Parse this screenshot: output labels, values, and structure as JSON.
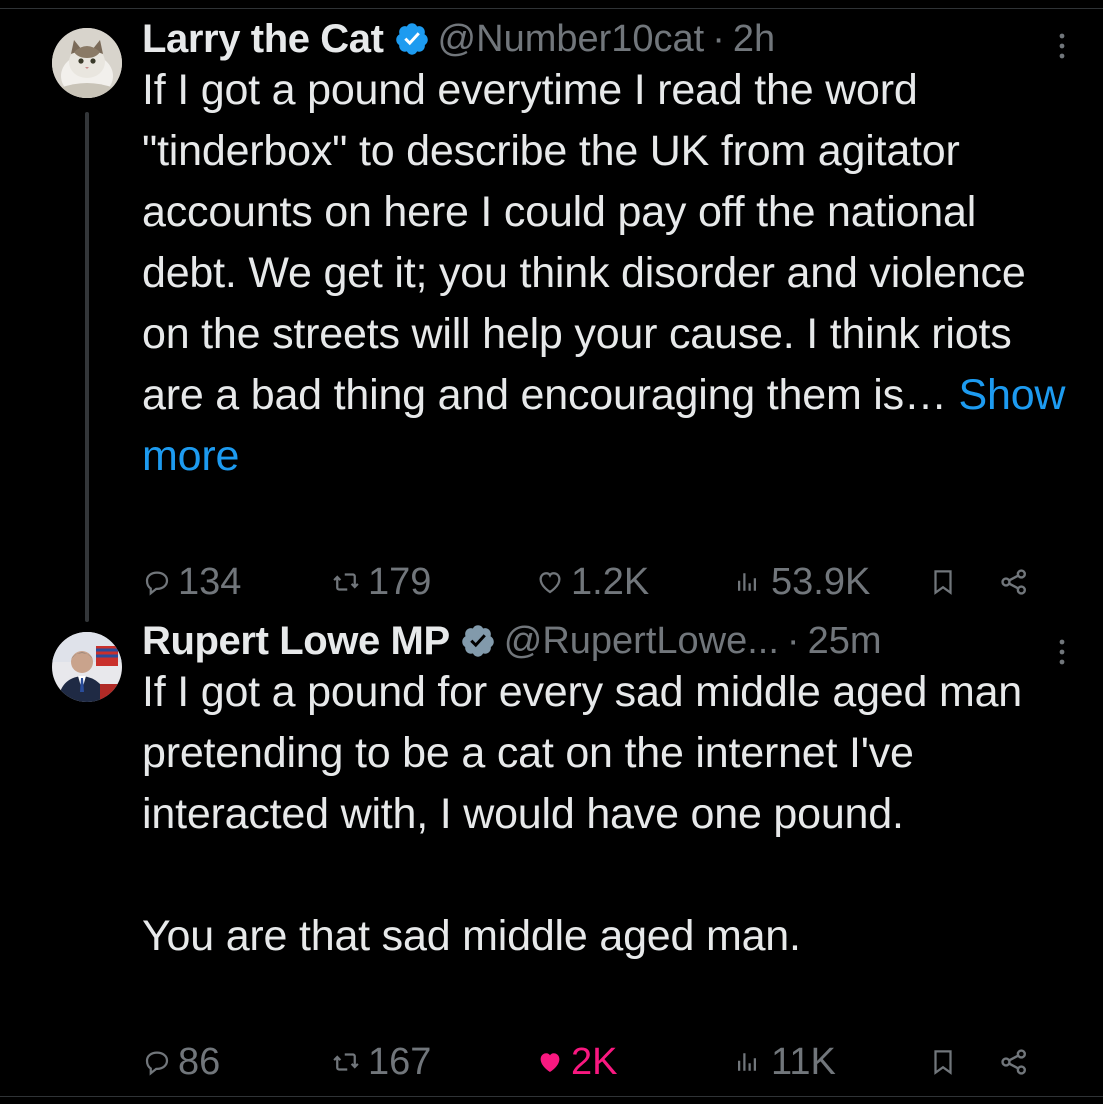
{
  "tweets": [
    {
      "author_name": "Larry the Cat",
      "handle": "@Number10cat",
      "time": "2h",
      "separator": "·",
      "body": "If I got a pound everytime I read the word \"tinderbox\" to describe the UK from agitator accounts on here I could pay off the national debt. We get it; you think disorder and violence on the streets will help your cause. I think riots are a bad thing and encouraging them is… ",
      "show_more": "Show more",
      "replies": "134",
      "reposts": "179",
      "likes": "1.2K",
      "views": "53.9K",
      "liked": false,
      "avatar_icon": "cat-avatar"
    },
    {
      "author_name": "Rupert Lowe MP",
      "handle": "@RupertLowe...",
      "time": "25m",
      "separator": "·",
      "body": "If I got a pound for every sad middle aged man pretending to be a cat on the internet I've interacted with, I would have one pound.\n\nYou are that sad middle aged man.",
      "replies": "86",
      "reposts": "167",
      "likes": "2K",
      "views": "11K",
      "liked": true,
      "avatar_icon": "person-avatar"
    }
  ],
  "colors": {
    "background": "#000000",
    "text": "#e7e9ea",
    "muted": "#71767b",
    "link": "#1d9bf0",
    "like": "#f91880",
    "verified_larry": "#1d9bf0",
    "verified_rupert": "#829aab"
  }
}
